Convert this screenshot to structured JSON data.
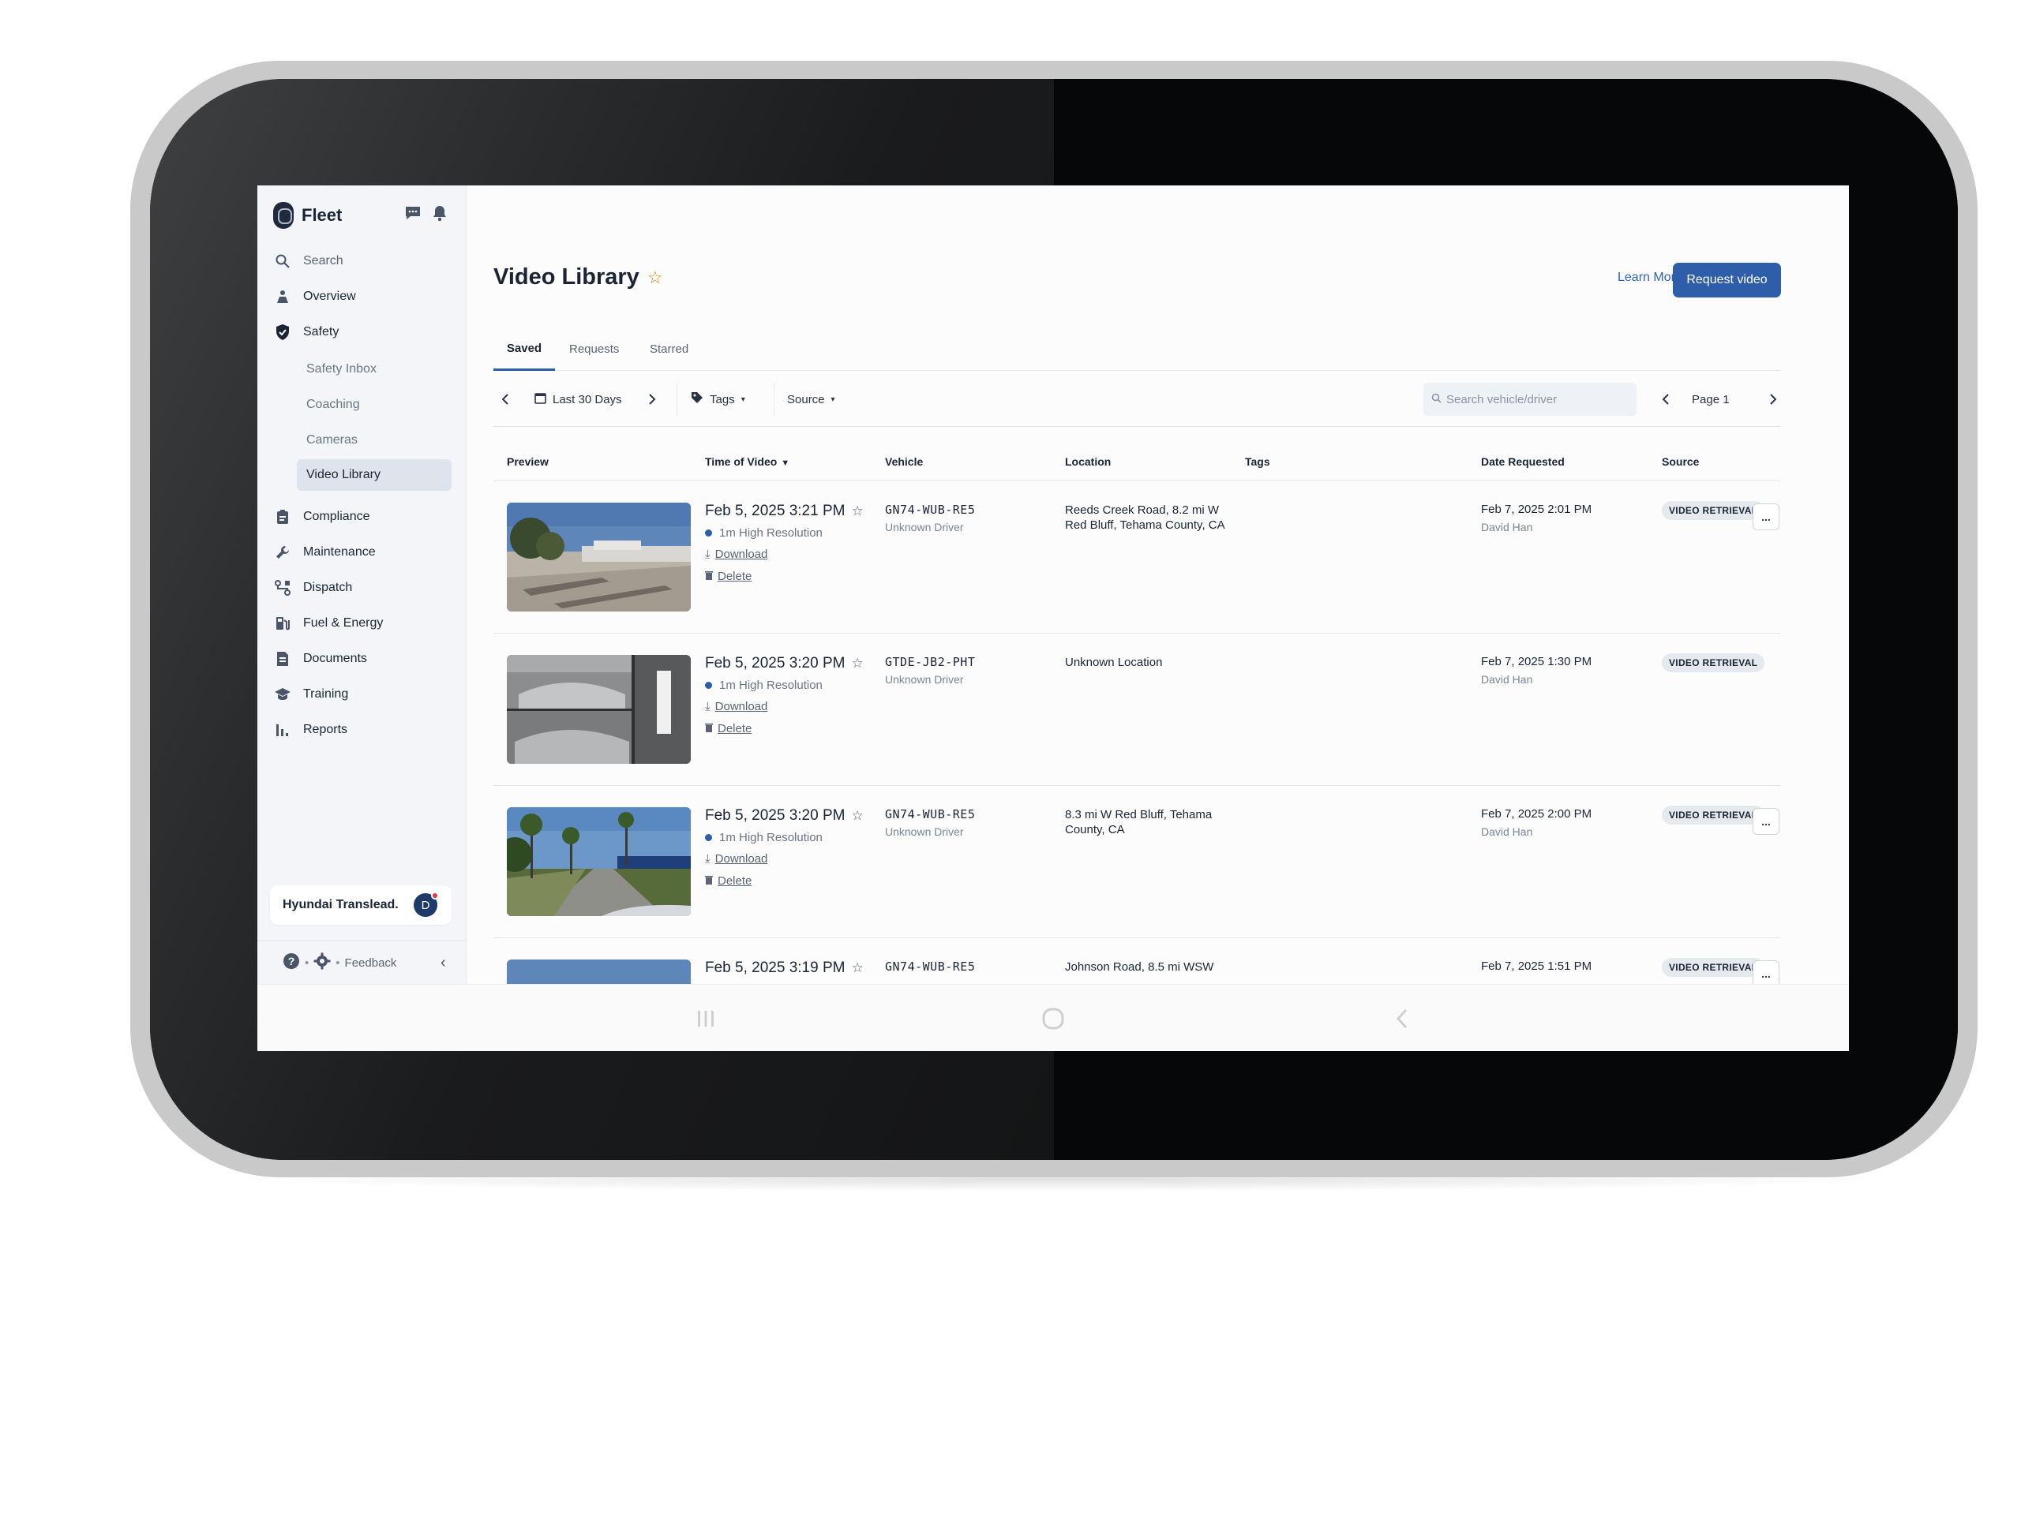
{
  "app": {
    "brand": "Fleet"
  },
  "sidebar": {
    "items": [
      {
        "label": "Search",
        "icon": "search-icon"
      },
      {
        "label": "Overview",
        "icon": "overview-icon"
      },
      {
        "label": "Safety",
        "icon": "shield-icon"
      },
      {
        "label": "Compliance",
        "icon": "clipboard-icon"
      },
      {
        "label": "Maintenance",
        "icon": "wrench-icon"
      },
      {
        "label": "Dispatch",
        "icon": "route-icon"
      },
      {
        "label": "Fuel & Energy",
        "icon": "fuel-icon"
      },
      {
        "label": "Documents",
        "icon": "document-icon"
      },
      {
        "label": "Training",
        "icon": "graduation-cap-icon"
      },
      {
        "label": "Reports",
        "icon": "bar-chart-icon"
      }
    ],
    "safety_sub": [
      {
        "label": "Safety Inbox"
      },
      {
        "label": "Coaching"
      },
      {
        "label": "Cameras"
      },
      {
        "label": "Video Library",
        "active": true
      }
    ],
    "org_name": "Hyundai Translead.",
    "avatar_initial": "D",
    "feedback_label": "Feedback"
  },
  "header": {
    "title": "Video Library",
    "learn_more": "Learn More",
    "request_button": "Request video"
  },
  "tabs": [
    "Saved",
    "Requests",
    "Starred"
  ],
  "filters": {
    "date_range": "Last 30 Days",
    "tags": "Tags",
    "source": "Source",
    "search_placeholder": "Search vehicle/driver",
    "page": "Page 1"
  },
  "table": {
    "columns": [
      "Preview",
      "Time of Video",
      "Vehicle",
      "Location",
      "Tags",
      "Date Requested",
      "Source"
    ],
    "download_label": "Download",
    "delete_label": "Delete",
    "more_label": "...",
    "rows": [
      {
        "time": "Feb 5, 2025 3:21 PM",
        "resolution": "1m High Resolution",
        "vehicle": "GN74-WUB-RE5",
        "driver": "Unknown Driver",
        "location": "Reeds Creek Road, 8.2 mi W Red Bluff, Tehama County, CA",
        "date_requested": "Feb 7, 2025 2:01 PM",
        "requester": "David Han",
        "source": "VIDEO RETRIEVAL"
      },
      {
        "time": "Feb 5, 2025 3:20 PM",
        "resolution": "1m High Resolution",
        "vehicle": "GTDE-JB2-PHT",
        "driver": "Unknown Driver",
        "location": "Unknown Location",
        "date_requested": "Feb 7, 2025 1:30 PM",
        "requester": "David Han",
        "source": "VIDEO RETRIEVAL"
      },
      {
        "time": "Feb 5, 2025 3:20 PM",
        "resolution": "1m High Resolution",
        "vehicle": "GN74-WUB-RE5",
        "driver": "Unknown Driver",
        "location": "8.3 mi W Red Bluff, Tehama County, CA",
        "date_requested": "Feb 7, 2025 2:00 PM",
        "requester": "David Han",
        "source": "VIDEO RETRIEVAL"
      },
      {
        "time": "Feb 5, 2025 3:19 PM",
        "vehicle": "GN74-WUB-RE5",
        "location": "Johnson Road, 8.5 mi WSW",
        "date_requested": "Feb 7, 2025 1:51 PM",
        "source": "VIDEO RETRIEVAL"
      }
    ]
  },
  "colors": {
    "accent": "#2e5eaa",
    "star": "#d98a1e",
    "notification_dot": "#e33a3a"
  }
}
